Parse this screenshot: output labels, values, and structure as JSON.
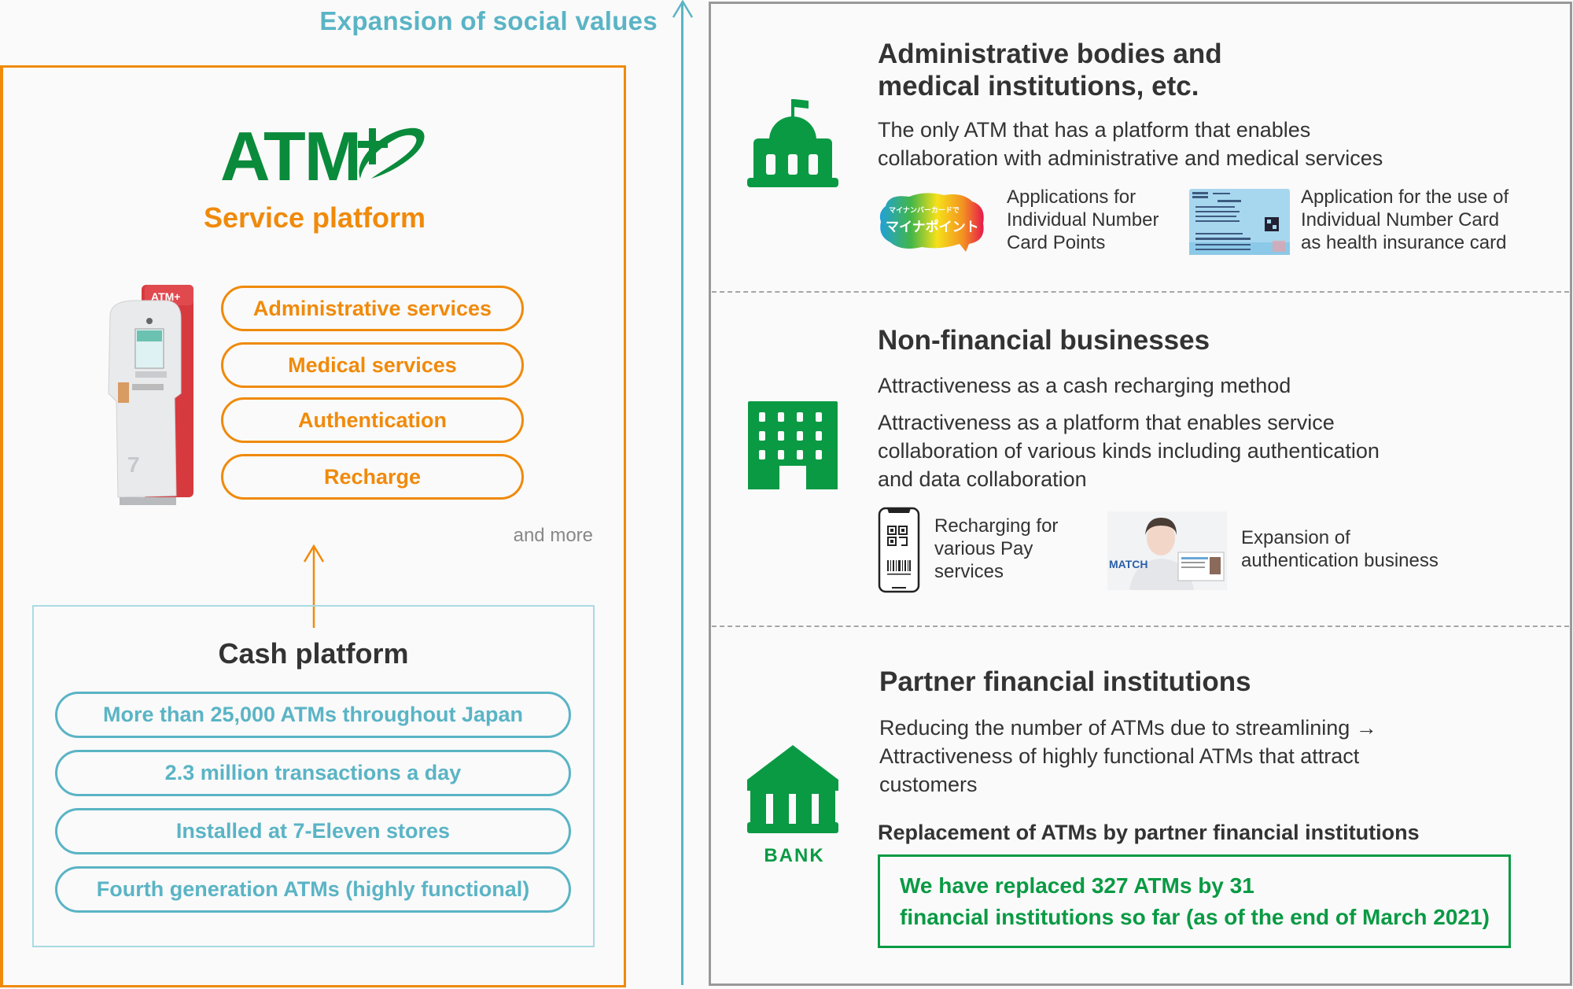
{
  "axis": {
    "title": "Expansion of social values",
    "color": "#5ab4c5"
  },
  "service_platform": {
    "logo_text": "ATM",
    "logo_plus": "+",
    "title": "Service platform",
    "accent_color": "#f08a0b",
    "machine_label": "ATM+",
    "services": [
      {
        "label": "Administrative services"
      },
      {
        "label": "Medical services"
      },
      {
        "label": "Authentication"
      },
      {
        "label": "Recharge"
      }
    ],
    "and_more": "and more"
  },
  "cash_platform": {
    "title": "Cash platform",
    "accent_color": "#5ab4c5",
    "facts": [
      {
        "label": "More than 25,000 ATMs throughout Japan"
      },
      {
        "label": "2.3 million transactions a day"
      },
      {
        "label": "Installed at 7-Eleven stores"
      },
      {
        "label": "Fourth generation ATMs (highly functional)"
      }
    ]
  },
  "right": {
    "icon_color": "#0a9a44",
    "sections": [
      {
        "icon": "government-building-icon",
        "title_lines": [
          "Administrative bodies and",
          "medical institutions, etc."
        ],
        "body_lines": [
          "The only ATM that has a platform that enables",
          "collaboration with administrative and medical services"
        ],
        "items": [
          {
            "image": "mynapoint-logo",
            "image_text_1": "マイナンバーカードで",
            "image_text_2": "マイナポイント",
            "lines": [
              "Applications for",
              "Individual Number",
              "Card Points"
            ]
          },
          {
            "image": "health-insurance-card",
            "lines": [
              "Application for the use of",
              "Individual Number Card",
              "as health insurance card"
            ]
          }
        ]
      },
      {
        "icon": "office-building-icon",
        "title": "Non-financial businesses",
        "body1": "Attractiveness as a cash recharging method",
        "body2_lines": [
          "Attractiveness as a platform that enables service",
          "collaboration of various kinds including authentication",
          "and data collaboration"
        ],
        "items": [
          {
            "image": "smartphone-qr-icon",
            "lines": [
              "Recharging for",
              "various Pay",
              "services"
            ]
          },
          {
            "image": "authentication-photo",
            "image_text": "MATCH",
            "lines": [
              "Expansion of",
              "authentication business"
            ]
          }
        ]
      },
      {
        "icon": "bank-icon",
        "icon_label": "BANK",
        "title": "Partner financial institutions",
        "body_lines": [
          "Reducing the number of ATMs due to streamlining →",
          "Attractiveness of highly functional ATMs that attract",
          "customers"
        ],
        "subheading": "Replacement of ATMs by partner financial institutions",
        "highlight_lines": [
          "We have replaced 327 ATMs by 31",
          "financial institutions so far (as of the end of March 2021)"
        ]
      }
    ]
  }
}
